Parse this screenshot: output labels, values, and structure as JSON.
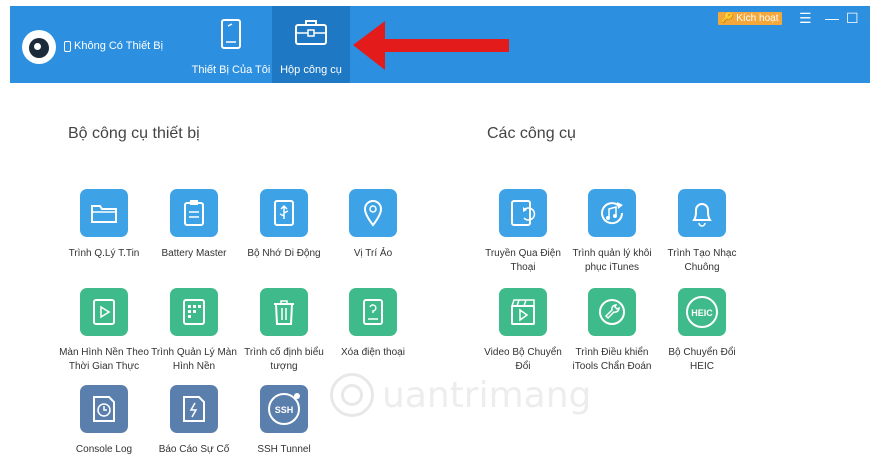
{
  "colors": {
    "header": "#2c8fe0",
    "active_tab": "#1f78c4",
    "arrow": "#e31b1b",
    "activate_badge": "#f4a73a",
    "tile_blue": "#3ea3e6",
    "tile_green": "#3fba8a",
    "tile_slate": "#5b7fad"
  },
  "header": {
    "device_status": "Không Có Thiết Bị",
    "tabs": [
      {
        "label": "Thiết Bị Của Tôi",
        "icon": "tablet-icon"
      },
      {
        "label": "Hộp công cụ",
        "icon": "toolbox-icon"
      }
    ],
    "activate": "Kích hoạt",
    "window_controls": [
      "menu-icon",
      "minimize-icon",
      "maximize-icon",
      "close-icon"
    ]
  },
  "sections": {
    "device_tools": {
      "title": "Bộ công cụ thiết bị",
      "tools": [
        {
          "label": "Trình Q.Lý T.Tin",
          "icon": "folder-icon"
        },
        {
          "label": "Battery Master",
          "icon": "clipboard-icon"
        },
        {
          "label": "Bộ Nhớ Di Động",
          "icon": "usb-icon"
        },
        {
          "label": "Vị Trí Ảo",
          "icon": "location-pin-icon"
        },
        {
          "label": "Màn Hình Nền Theo Thời Gian Thực",
          "icon": "play-video-icon"
        },
        {
          "label": "Trình Quản Lý Màn Hình Nền",
          "icon": "app-grid-icon"
        },
        {
          "label": "Trình cố định biểu tượng",
          "icon": "trash-icon"
        },
        {
          "label": "Xóa điện thoại",
          "icon": "phone-question-icon"
        },
        {
          "label": "Console Log",
          "icon": "clock-document-icon"
        },
        {
          "label": "Báo Cáo Sự Cố",
          "icon": "crash-report-icon"
        },
        {
          "label": "SSH Tunnel",
          "icon": "ssh-icon",
          "badge_text": "SSH"
        }
      ]
    },
    "other_tools": {
      "title": "Các công cụ",
      "tools": [
        {
          "label": "Truyền Qua Điện Thoại",
          "icon": "phone-transfer-icon"
        },
        {
          "label": "Trình quản lý khôi phục iTunes",
          "icon": "music-restore-icon"
        },
        {
          "label": "Trình Tạo Nhạc Chuông",
          "icon": "bell-icon"
        },
        {
          "label": "Video Bộ Chuyển Đổi",
          "icon": "video-clapper-icon"
        },
        {
          "label": "Trình Điều khiển iTools Chẩn Đoán",
          "icon": "wrench-icon"
        },
        {
          "label": "Bộ Chuyển Đổi HEIC",
          "icon": "heic-icon",
          "badge_text": "HEIC"
        }
      ]
    }
  }
}
